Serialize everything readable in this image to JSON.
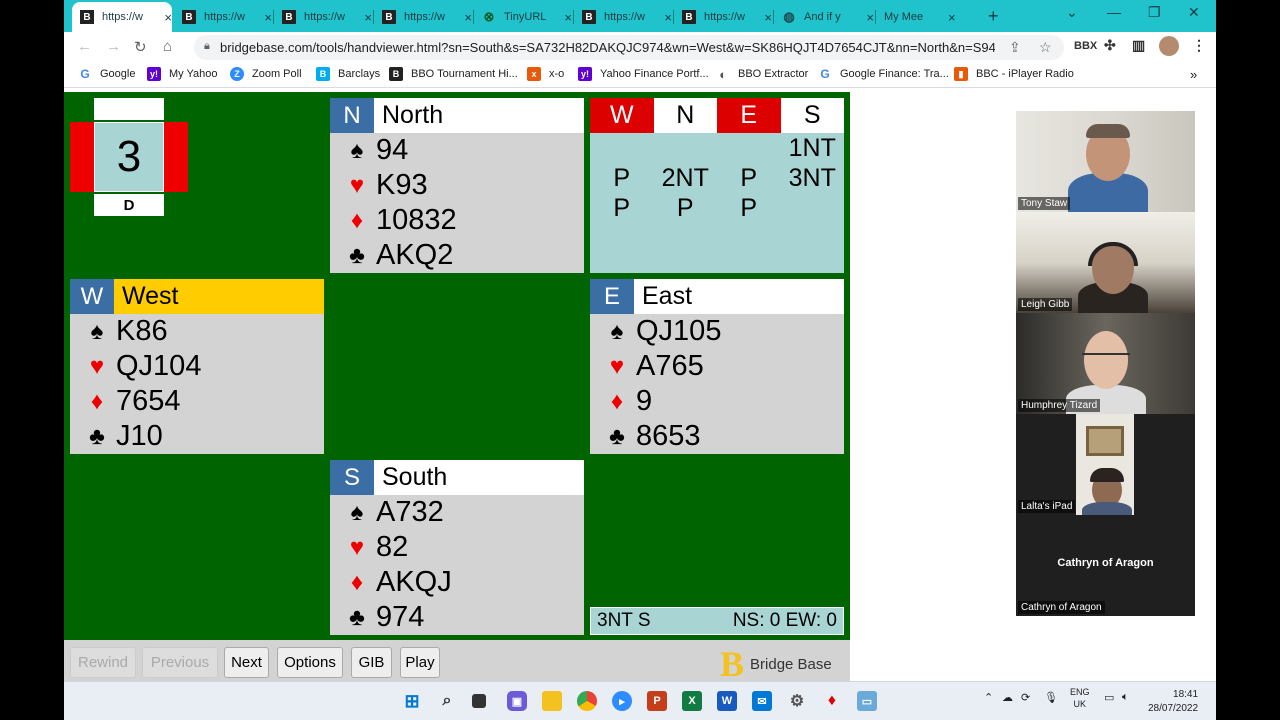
{
  "browser": {
    "tabs": [
      {
        "title": "https://w",
        "icon": "B",
        "active": true
      },
      {
        "title": "https://w",
        "icon": "B"
      },
      {
        "title": "https://w",
        "icon": "B"
      },
      {
        "title": "https://w",
        "icon": "B"
      },
      {
        "title": "TinyURL",
        "icon": "tinyurl"
      },
      {
        "title": "https://w",
        "icon": "B"
      },
      {
        "title": "https://w",
        "icon": "B"
      },
      {
        "title": "And if y",
        "icon": "globe"
      },
      {
        "title": "My Mee",
        "icon": "zoom"
      }
    ],
    "close_glyph": "×",
    "new_tab": "+",
    "url": "bridgebase.com/tools/handviewer.html?sn=South&s=SA732H82DAKQJC974&wn=West&w=SK86HQJT4D7654CJT&nn=North&n=S94HK9...",
    "bookmarks": [
      {
        "label": "Google",
        "icon": "G",
        "color": "#4285f4"
      },
      {
        "label": "My Yahoo",
        "icon": "y!",
        "color": "#6001d2"
      },
      {
        "label": "Zoom Poll",
        "icon": "Z",
        "color": "#2d8cff"
      },
      {
        "label": "Barclays",
        "icon": "B",
        "color": "#00aeef"
      },
      {
        "label": "BBO Tournament Hi...",
        "icon": "B",
        "color": "#222222"
      },
      {
        "label": "x-o",
        "icon": "x",
        "color": "#e8590c"
      },
      {
        "label": "Yahoo Finance Portf...",
        "icon": "y!",
        "color": "#6001d2"
      },
      {
        "label": "BBO Extractor",
        "icon": "◐",
        "color": "#555555"
      },
      {
        "label": "Google Finance: Tra...",
        "icon": "G",
        "color": "#4285f4"
      },
      {
        "label": "BBC - iPlayer Radio",
        "icon": "▮",
        "color": "#f54997"
      }
    ],
    "bookmarks_more": "»",
    "ext_label": "BBX"
  },
  "board": {
    "number": "3",
    "dealer": "D"
  },
  "hands": {
    "north": {
      "dir": "N",
      "name": "North",
      "spades": "94",
      "hearts": "K93",
      "diamonds": "10832",
      "clubs": "AKQ2"
    },
    "west": {
      "dir": "W",
      "name": "West",
      "spades": "K86",
      "hearts": "QJ104",
      "diamonds": "7654",
      "clubs": "J10"
    },
    "east": {
      "dir": "E",
      "name": "East",
      "spades": "QJ105",
      "hearts": "A765",
      "diamonds": "9",
      "clubs": "8653"
    },
    "south": {
      "dir": "S",
      "name": "South",
      "spades": "A732",
      "hearts": "82",
      "diamonds": "AKQJ",
      "clubs": "974"
    }
  },
  "suit_symbols": {
    "spades": "♠",
    "hearts": "♥",
    "diamonds": "♦",
    "clubs": "♣"
  },
  "bidding": {
    "headers": [
      "W",
      "N",
      "E",
      "S"
    ],
    "rows": [
      [
        "",
        "",
        "",
        "1NT"
      ],
      [
        "P",
        "2NT",
        "P",
        "3NT"
      ],
      [
        "P",
        "P",
        "P",
        ""
      ]
    ]
  },
  "contract": {
    "text": "3NT S",
    "score": "NS: 0 EW: 0"
  },
  "controls": {
    "rewind": "Rewind",
    "previous": "Previous",
    "next": "Next",
    "options": "Options",
    "gib": "GIB",
    "play": "Play"
  },
  "logo": {
    "letter": "B",
    "text": "Bridge Base"
  },
  "participants": [
    {
      "name": "Tony Staw"
    },
    {
      "name": "Leigh Gibb"
    },
    {
      "name": "Humphrey Tizard"
    },
    {
      "name": "Lalta's iPad"
    },
    {
      "name": "Cathryn of Aragon",
      "title": "Cathryn of Aragon"
    }
  ],
  "taskbar": {
    "lang1": "ENG",
    "lang2": "UK",
    "time": "18:41",
    "date": "28/07/2022"
  },
  "colors": {
    "table_green": "#006400",
    "vulnerable_red": "#dd0000",
    "bid_box": "#a8d4d4",
    "dir_blue": "#3a6ea5",
    "turn_yellow": "#ffcc00",
    "tab_strip": "#20c2cc"
  }
}
